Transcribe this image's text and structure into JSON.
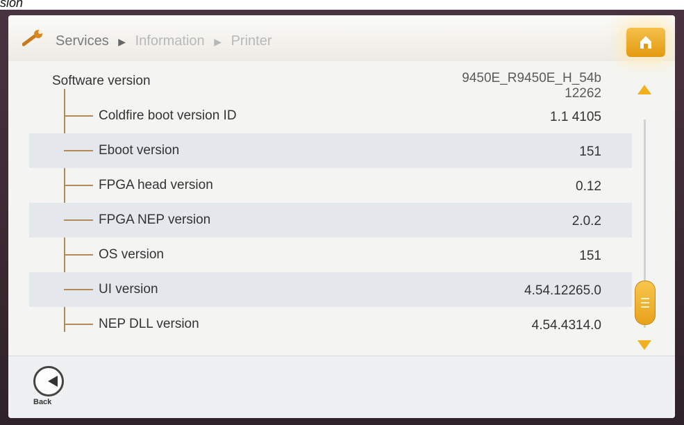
{
  "caption": "sion",
  "header": {
    "icon": "wrench-icon",
    "breadcrumb": [
      "Services",
      "Information",
      "Printer"
    ],
    "home_icon": "home-icon"
  },
  "list": {
    "root": {
      "label": "Software version",
      "value_line1": "9450E_R9450E_H_54b",
      "value_line2": "12262"
    },
    "items": [
      {
        "label": "Coldfire boot version ID",
        "value": "1.1 4105"
      },
      {
        "label": "Eboot version",
        "value": "151"
      },
      {
        "label": "FPGA head version",
        "value": "0.12"
      },
      {
        "label": "FPGA NEP version",
        "value": "2.0.2"
      },
      {
        "label": "OS version",
        "value": "151"
      },
      {
        "label": "UI version",
        "value": "4.54.12265.0"
      },
      {
        "label": "NEP DLL version",
        "value": "4.54.4314.0"
      }
    ]
  },
  "footer": {
    "back_label": "Back"
  },
  "colors": {
    "accent": "#f0b020",
    "tree_line": "#b58a56",
    "row_alt": "#e4e8ec"
  }
}
